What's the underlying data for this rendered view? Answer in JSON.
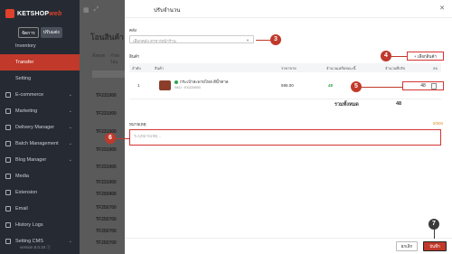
{
  "sidebar": {
    "brand": "KETSHOP",
    "brand_accent": "web",
    "mode_buttons": [
      "จัดการ",
      "ปรับแต่ง"
    ],
    "items": [
      {
        "label": "Inventory",
        "sub": true
      },
      {
        "label": "Transfer",
        "sub": true,
        "active": true
      },
      {
        "label": "Setting",
        "sub": true
      },
      {
        "label": "E-commerce",
        "chevron": true
      },
      {
        "label": "Marketing",
        "chevron": true
      },
      {
        "label": "Delivery Manager",
        "chevron": true
      },
      {
        "label": "Batch Management",
        "chevron": true
      },
      {
        "label": "Blog Manager",
        "chevron": true
      },
      {
        "label": "Media"
      },
      {
        "label": "Extension"
      },
      {
        "label": "Email"
      },
      {
        "label": "History Logs"
      },
      {
        "label": "Setting CMS",
        "chevron": true
      }
    ],
    "version": "version 8.0.34 ⓒ"
  },
  "background": {
    "title": "โอนสินค้า",
    "tabs": [
      "ทั้งหมด",
      "กำลังโอน"
    ],
    "rows": [
      "TF231000",
      "TF231000",
      "TF231000",
      "TF231000",
      "TF231000",
      "TF231000",
      "TF250900",
      "TF250700",
      "TF250700",
      "TF250700",
      "TF250700",
      "TF250700"
    ]
  },
  "modal": {
    "title": "ปรับจำนวน",
    "warehouse_label": "คลัง",
    "warehouse_placeholder": "เลือกคลัง สาขา/หน้าร้าน",
    "products_label": "สินค้า",
    "add_product_button": "+ เลือกสินค้า",
    "table_headers": [
      "ลำดับ",
      "สินค้า",
      "ราคาขาย",
      "จำนวนเหลือขณะนี้",
      "จำนวนที่ปรับ",
      "ลบ"
    ],
    "rows": [
      {
        "index": "1",
        "name": "กระเป๋าสะพายไหล่ สีน้ำตาล",
        "sku": "SKU : EX220693",
        "price": "695.00",
        "remaining": "48",
        "adjust": "48"
      }
    ],
    "total_label": "รวมทั้งหมด",
    "total_value": "48",
    "note_label": "หมายเหตุ",
    "note_placeholder": "ระบุหมายเหตุ...",
    "note_counter": "0/500",
    "cancel_button": "ยกเลิก",
    "save_button": "บันทึก"
  },
  "callouts": [
    "3",
    "4",
    "5",
    "6",
    "7"
  ],
  "colors": {
    "accent": "#c0392b",
    "status_green": "#2ea44f",
    "counter_orange": "#e0902c",
    "sidebar_bg": "#262b33"
  }
}
